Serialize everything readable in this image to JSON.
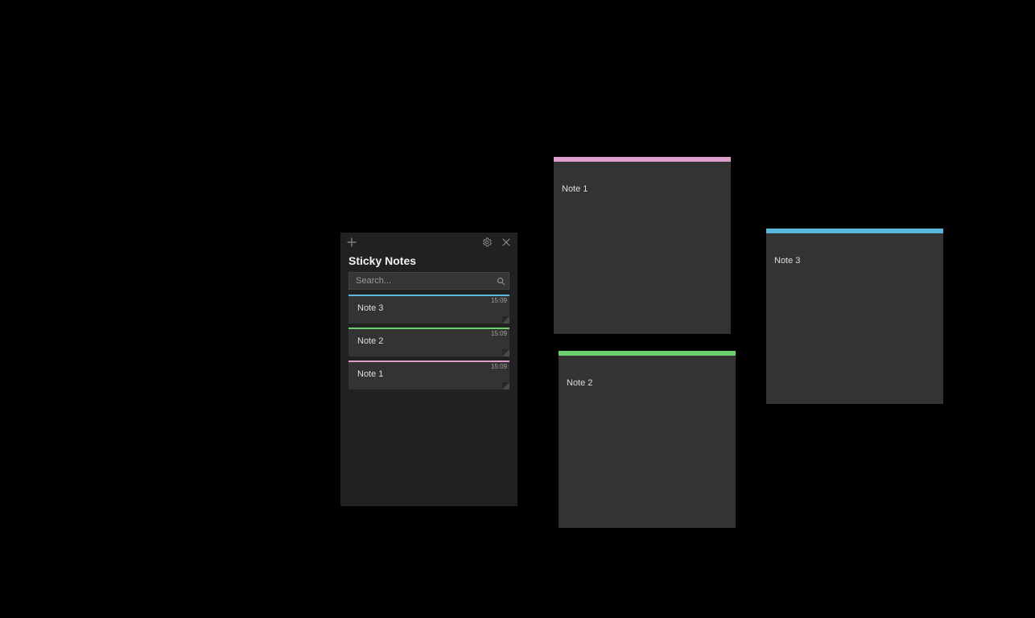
{
  "app": {
    "title": "Sticky Notes",
    "search_placeholder": "Search..."
  },
  "colors": {
    "blue": "#59b7dc",
    "green": "#6fcf6f",
    "pink": "#de9ecb"
  },
  "list": {
    "items": [
      {
        "title": "Note 3",
        "time": "15:09",
        "color": "blue"
      },
      {
        "title": "Note 2",
        "time": "15:09",
        "color": "green"
      },
      {
        "title": "Note 1",
        "time": "15:09",
        "color": "pink"
      }
    ]
  },
  "notes": [
    {
      "id": "note1",
      "content": "Note 1",
      "color": "pink"
    },
    {
      "id": "note2",
      "content": "Note 2",
      "color": "green"
    },
    {
      "id": "note3",
      "content": "Note 3",
      "color": "blue"
    }
  ]
}
